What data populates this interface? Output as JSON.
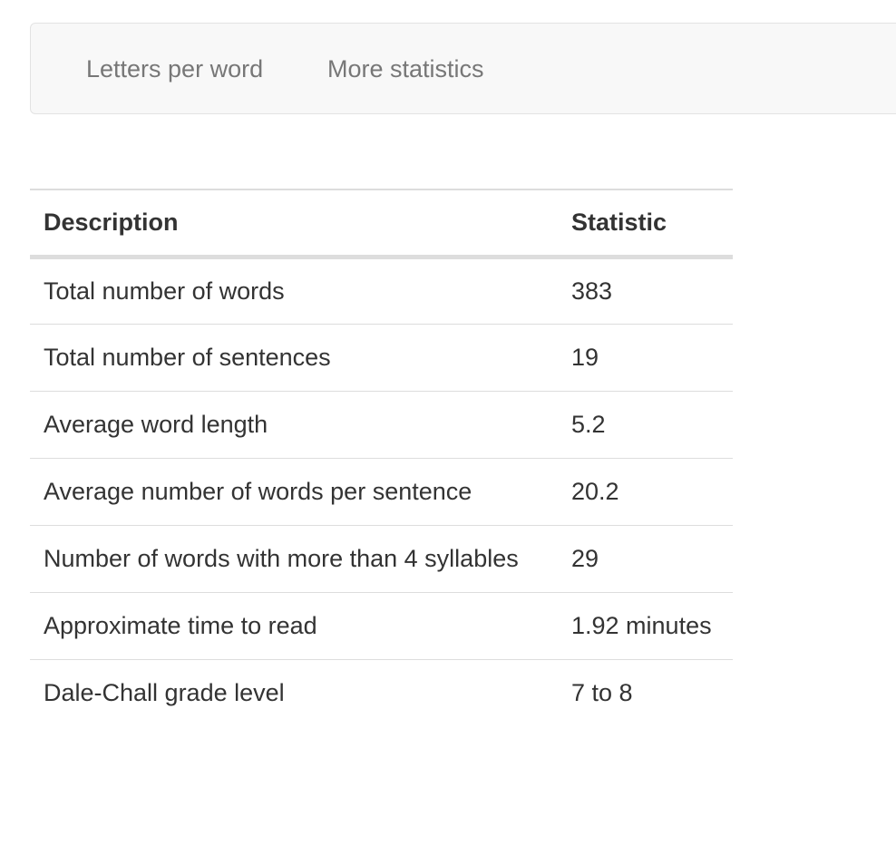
{
  "nav": {
    "items": [
      {
        "label": "Letters per word"
      },
      {
        "label": "More statistics"
      }
    ]
  },
  "table": {
    "headers": {
      "description": "Description",
      "statistic": "Statistic"
    },
    "rows": [
      {
        "description": "Total number of words",
        "statistic": "383"
      },
      {
        "description": "Total number of sentences",
        "statistic": "19"
      },
      {
        "description": "Average word length",
        "statistic": "5.2"
      },
      {
        "description": "Average number of words per sentence",
        "statistic": "20.2"
      },
      {
        "description": "Number of words with more than 4 syllables",
        "statistic": "29"
      },
      {
        "description": "Approximate time to read",
        "statistic": "1.92 minutes"
      },
      {
        "description": "Dale-Chall grade level",
        "statistic": "7 to 8"
      }
    ]
  }
}
